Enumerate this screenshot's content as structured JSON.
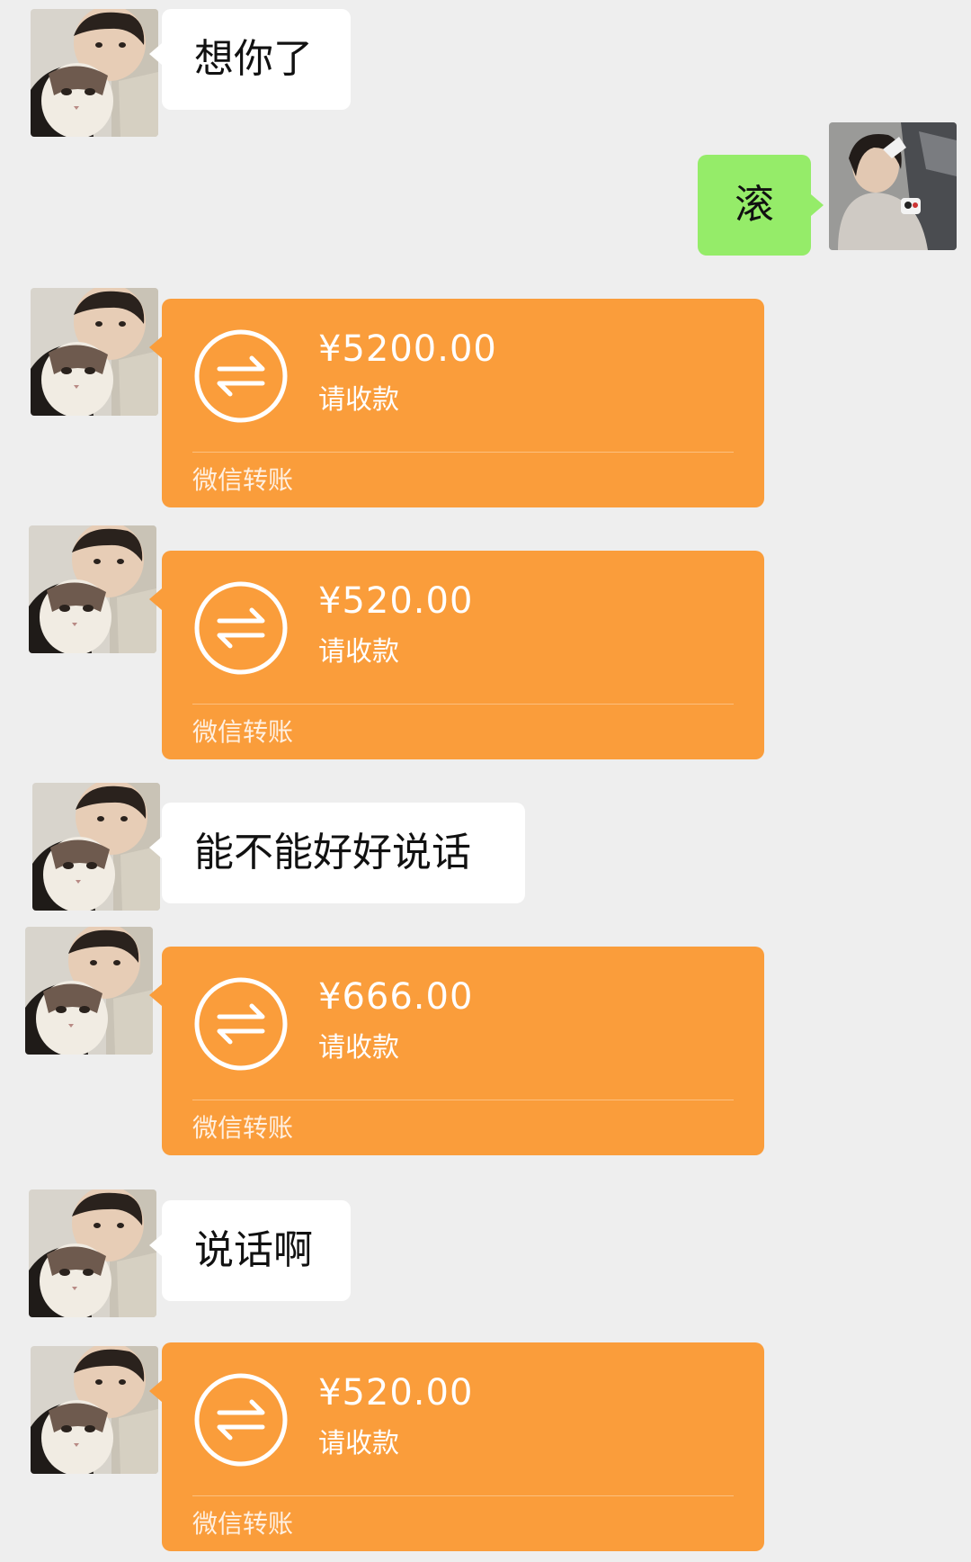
{
  "colors": {
    "background": "#eeeeee",
    "incoming_bubble": "#ffffff",
    "outgoing_bubble": "#95ec69",
    "transfer_card": "#fa9d3b"
  },
  "messages": [
    {
      "type": "text",
      "side": "left",
      "text": "想你了"
    },
    {
      "type": "text",
      "side": "right",
      "text": "滚"
    },
    {
      "type": "transfer",
      "side": "left",
      "amount": "¥5200.00",
      "status": "请收款",
      "footer": "微信转账",
      "icon": "transfer-arrows-icon"
    },
    {
      "type": "transfer",
      "side": "left",
      "amount": "¥520.00",
      "status": "请收款",
      "footer": "微信转账",
      "icon": "transfer-arrows-icon"
    },
    {
      "type": "text",
      "side": "left",
      "text": "能不能好好说话"
    },
    {
      "type": "transfer",
      "side": "left",
      "amount": "¥666.00",
      "status": "请收款",
      "footer": "微信转账",
      "icon": "transfer-arrows-icon"
    },
    {
      "type": "text",
      "side": "left",
      "text": "说话啊"
    },
    {
      "type": "transfer",
      "side": "left",
      "amount": "¥520.00",
      "status": "请收款",
      "footer": "微信转账",
      "icon": "transfer-arrows-icon"
    }
  ]
}
